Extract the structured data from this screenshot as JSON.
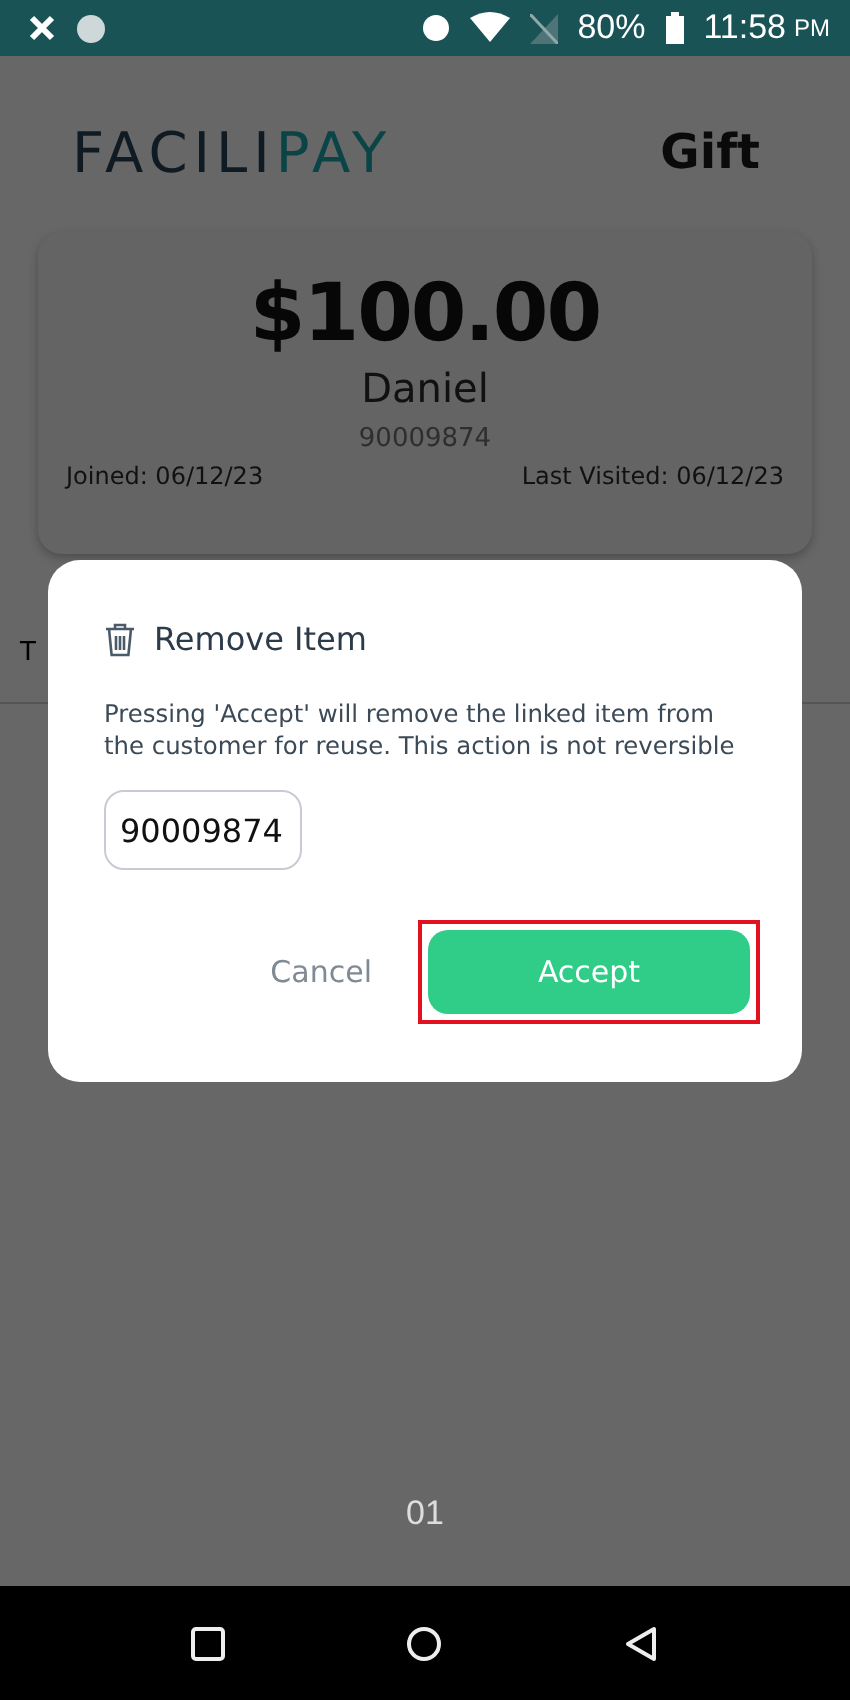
{
  "status_bar": {
    "battery": "80%",
    "time": "11:58",
    "ampm": "PM"
  },
  "header": {
    "logo": {
      "dark": "FACILI",
      "accent": "PAY"
    },
    "title": "Gift"
  },
  "card": {
    "balance": "$100.00",
    "name": "Daniel",
    "number": "90009874",
    "joined": "Joined: 06/12/23",
    "last_visited": "Last Visited: 06/12/23"
  },
  "tabs": [
    {
      "label": "T"
    }
  ],
  "footer": {
    "page": "01"
  },
  "dialog": {
    "title": "Remove Item",
    "message": "Pressing 'Accept' will remove the linked item from the customer for reuse. This action is not reversible",
    "value": "90009874",
    "buttons": [
      {
        "label": "Cancel",
        "kind": "text",
        "highlighted": false
      },
      {
        "label": "Accept",
        "kind": "primary",
        "highlighted": true
      }
    ]
  }
}
